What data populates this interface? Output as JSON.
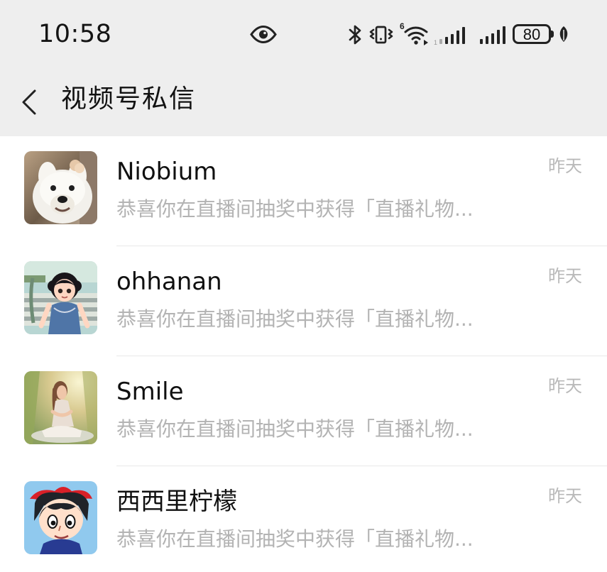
{
  "status_bar": {
    "time": "10:58",
    "wifi_label": "6",
    "battery": "80",
    "icons": [
      "eye-icon",
      "bluetooth-icon",
      "vibrate-icon",
      "wifi-icon",
      "signal-icon",
      "battery-icon",
      "leaf-icon"
    ]
  },
  "navigation": {
    "title": "视频号私信",
    "back_icon": "chevron-left-icon"
  },
  "messages": [
    {
      "name": "Niobium",
      "preview": "恭喜你在直播间抽奖中获得「直播礼物...",
      "time": "昨天",
      "avatar": "white-dog-avatar"
    },
    {
      "name": "ohhanan",
      "preview": "恭喜你在直播间抽奖中获得「直播礼物...",
      "time": "昨天",
      "avatar": "girl-on-stairs-avatar"
    },
    {
      "name": "Smile",
      "preview": "恭喜你在直播间抽奖中获得「直播礼物...",
      "time": "昨天",
      "avatar": "sitting-girl-avatar"
    },
    {
      "name": "西西里柠檬",
      "preview": "恭喜你在直播间抽奖中获得「直播礼物...",
      "time": "昨天",
      "avatar": "witch-girl-avatar"
    }
  ],
  "colors": {
    "header_background": "#eeeeee",
    "list_background": "#ffffff",
    "primary_text": "#111111",
    "secondary_text": "#b3b3b3",
    "divider": "#e8e8e8"
  }
}
